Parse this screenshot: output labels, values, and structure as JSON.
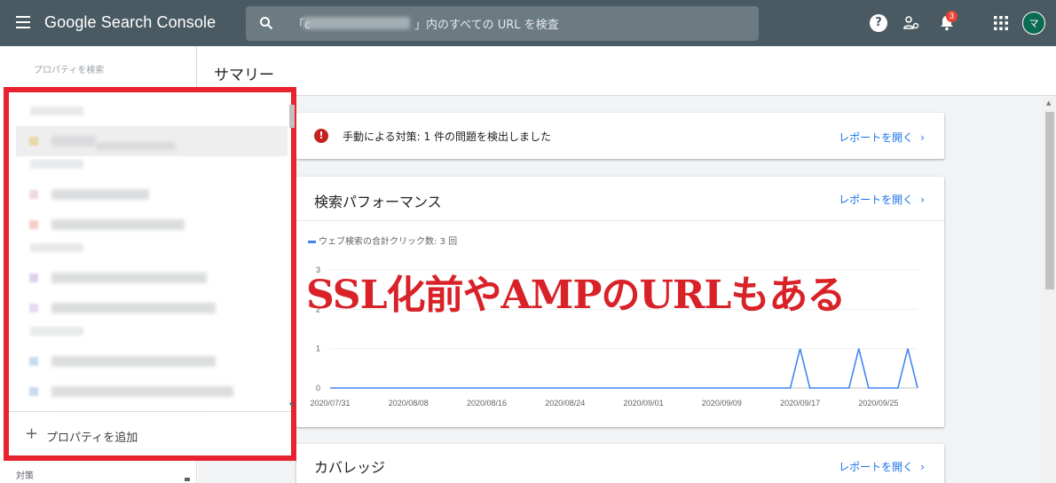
{
  "header": {
    "app_title": "Google Search Console",
    "search_prefix": "「c",
    "search_suffix": "」内のすべての URL を検査",
    "help_glyph": "?",
    "notification_count": "3",
    "avatar_initial": "マ"
  },
  "sidebar": {
    "property_search_label": "プロパティを検索",
    "bottom_label": "対策"
  },
  "dropdown": {
    "add_property_label": "プロパティを追加",
    "rows": [
      {
        "type": "group",
        "y": 0
      },
      {
        "type": "item",
        "selected": true,
        "fav_color": "#e8d7a8",
        "widths": [
          50,
          90
        ]
      },
      {
        "type": "group",
        "y": 72
      },
      {
        "type": "item",
        "fav_color": "#eedae2",
        "widths": [
          110
        ]
      },
      {
        "type": "item",
        "fav_color": "#f6cfc8",
        "widths": [
          150
        ]
      },
      {
        "type": "group",
        "y": 165
      },
      {
        "type": "item",
        "fav_color": "#ddd3ea",
        "widths": [
          175
        ]
      },
      {
        "type": "item",
        "fav_color": "#e6dbee",
        "widths": [
          185
        ]
      },
      {
        "type": "group",
        "y": 258
      },
      {
        "type": "item",
        "fav_color": "#c9dcef",
        "widths": [
          185
        ]
      },
      {
        "type": "item",
        "fav_color": "#c9dcef",
        "widths": [
          205
        ]
      },
      {
        "type": "item",
        "fav_color": "#c9dcef",
        "widths": [
          175
        ]
      }
    ]
  },
  "main": {
    "page_title": "サマリー",
    "alert": {
      "text": "手動による対策: 1 件の問題を検出しました",
      "icon": "!",
      "link": "レポートを開く"
    },
    "performance": {
      "title": "検索パフォーマンス",
      "link": "レポートを開く",
      "legend": "ウェブ検索の合計クリック数: 3 回"
    },
    "coverage": {
      "title": "カバレッジ",
      "link": "レポートを開く"
    },
    "overlay_text": "SSL化前やAMPのURLもある"
  },
  "chart_data": {
    "type": "line",
    "series": [
      {
        "name": "ウェブ検索の合計クリック数",
        "color": "#4285f4"
      }
    ],
    "x_ticks": [
      "2020/07/31",
      "2020/08/08",
      "2020/08/16",
      "2020/08/24",
      "2020/09/01",
      "2020/09/09",
      "2020/09/17",
      "2020/09/25"
    ],
    "y_ticks": [
      0,
      1,
      2,
      3
    ],
    "ylim": [
      0,
      3
    ],
    "start_date": "2020-07-31",
    "end_date": "2020-09-29",
    "points": [
      {
        "x": "2020-07-31",
        "y": 0
      },
      {
        "x": "2020-09-16",
        "y": 0
      },
      {
        "x": "2020-09-17",
        "y": 1
      },
      {
        "x": "2020-09-18",
        "y": 0
      },
      {
        "x": "2020-09-22",
        "y": 0
      },
      {
        "x": "2020-09-23",
        "y": 1
      },
      {
        "x": "2020-09-24",
        "y": 0
      },
      {
        "x": "2020-09-27",
        "y": 0
      },
      {
        "x": "2020-09-28",
        "y": 1
      },
      {
        "x": "2020-09-29",
        "y": 0
      }
    ],
    "grid": true
  }
}
